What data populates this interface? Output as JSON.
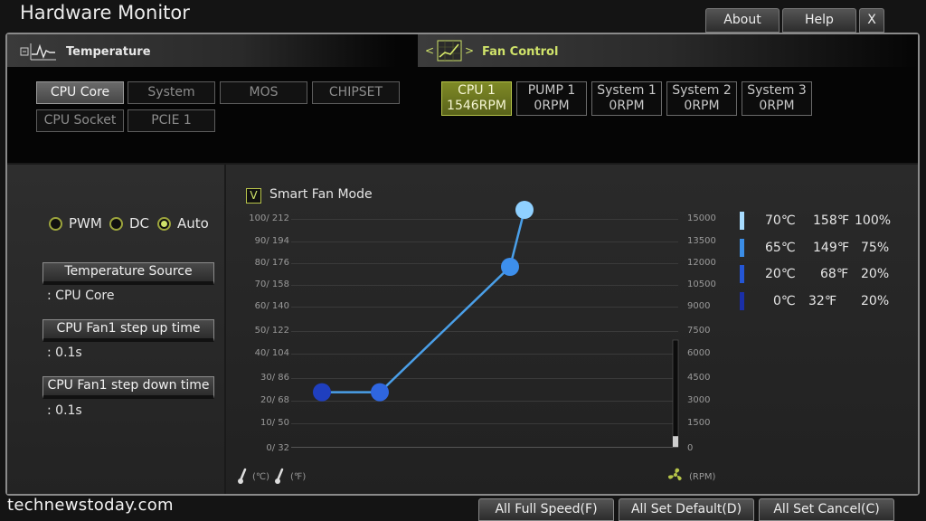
{
  "app": {
    "title": "Hardware Monitor",
    "about_label": "About",
    "help_label": "Help",
    "close_label": "X"
  },
  "temperature": {
    "header_label": "Temperature",
    "sources": [
      "CPU Core",
      "System",
      "MOS",
      "CHIPSET",
      "CPU Socket",
      "PCIE 1"
    ],
    "active_source": "CPU Core"
  },
  "fan_control": {
    "header_label": "Fan Control",
    "nav_prev": "<",
    "nav_next": ">",
    "fans": [
      {
        "name": "CPU 1",
        "rpm": "1546RPM",
        "active": true
      },
      {
        "name": "PUMP 1",
        "rpm": "0RPM",
        "active": false
      },
      {
        "name": "System 1",
        "rpm": "0RPM",
        "active": false
      },
      {
        "name": "System 2",
        "rpm": "0RPM",
        "active": false
      },
      {
        "name": "System 3",
        "rpm": "0RPM",
        "active": false
      }
    ]
  },
  "mode": {
    "options": [
      "PWM",
      "DC",
      "Auto"
    ],
    "selected": "Auto"
  },
  "settings": {
    "temp_source_label": "Temperature Source",
    "temp_source_value": ": CPU Core",
    "step_up_label": "CPU Fan1 step up time",
    "step_up_value": ": 0.1s",
    "step_down_label": "CPU Fan1 step down time",
    "step_down_value": ": 0.1s"
  },
  "smart_fan": {
    "label": "Smart Fan Mode",
    "checked": true,
    "check_glyph": "V"
  },
  "chart_data": {
    "type": "line",
    "left_axis_ticks": [
      "100/ 212",
      "90/ 194",
      "80/ 176",
      "70/ 158",
      "60/ 140",
      "50/ 122",
      "40/ 104",
      "30/  86",
      "20/  68",
      "10/  50",
      "0/  32"
    ],
    "right_axis_ticks": [
      "15000",
      "13500",
      "12000",
      "10500",
      "9000",
      "7500",
      "6000",
      "4500",
      "3000",
      "1500",
      "0"
    ],
    "points": [
      {
        "temp_c": 0,
        "percent": 20,
        "color": "#1f3fbf"
      },
      {
        "temp_c": 20,
        "percent": 20,
        "color": "#2f66e0"
      },
      {
        "temp_c": 65,
        "percent": 75,
        "color": "#3d8fec"
      },
      {
        "temp_c": 70,
        "percent": 100,
        "color": "#8fd0ff"
      }
    ],
    "y_c_range": [
      0,
      100
    ],
    "line_color": "#4a9fe8",
    "current_rpm_fraction": 0.1,
    "unit_left_c": "(℃)",
    "unit_left_f": "(℉)",
    "unit_right": "(RPM)"
  },
  "legend": [
    {
      "c": "70℃",
      "f": "158℉",
      "pct": "100%",
      "color": "#a8dcff"
    },
    {
      "c": "65℃",
      "f": "149℉",
      "pct": "75%",
      "color": "#3b8de6"
    },
    {
      "c": "20℃",
      "f": "68℉",
      "pct": "20%",
      "color": "#2456d6"
    },
    {
      "c": "0℃",
      "f": "32℉",
      "pct": "20%",
      "color": "#1a2fa8"
    }
  ],
  "footer": {
    "full_speed_label": "All Full Speed(F)",
    "set_default_label": "All Set Default(D)",
    "set_cancel_label": "All Set Cancel(C)"
  },
  "watermark": "technewstoday.com"
}
